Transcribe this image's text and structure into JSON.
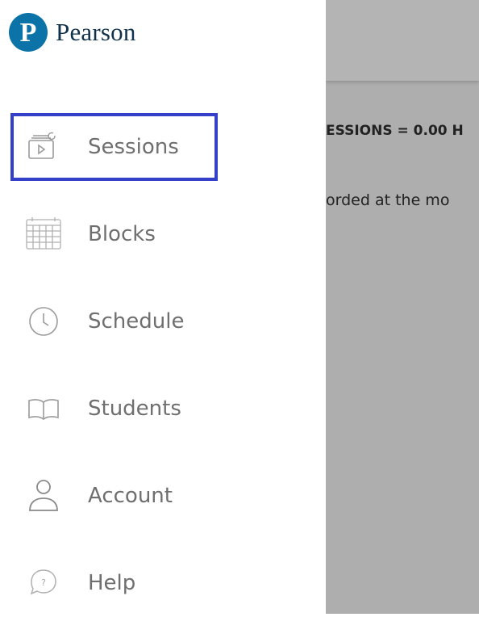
{
  "brand": {
    "name": "Pearson",
    "logo_letter": "P",
    "color": "#0b73a8"
  },
  "nav": {
    "selected_color": "#3540c8",
    "items": [
      {
        "label": "Sessions",
        "icon": "sessions-icon",
        "selected": true
      },
      {
        "label": "Blocks",
        "icon": "calendar-grid-icon",
        "selected": false
      },
      {
        "label": "Schedule",
        "icon": "clock-icon",
        "selected": false
      },
      {
        "label": "Students",
        "icon": "open-book-icon",
        "selected": false
      },
      {
        "label": "Account",
        "icon": "user-icon",
        "selected": false
      },
      {
        "label": "Help",
        "icon": "help-icon",
        "selected": false
      }
    ]
  },
  "content": {
    "summary_text": "ESSIONS = 0.00 H",
    "message_text": "orded at the mo"
  }
}
